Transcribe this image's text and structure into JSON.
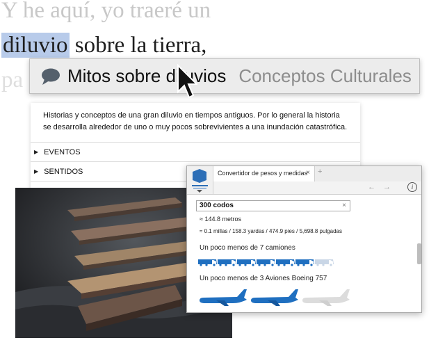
{
  "verse": {
    "line1": "Y he aquí, yo traeré un",
    "line2_highlight": "diluvio",
    "line2_rest": " sobre la tierra,",
    "line3": "pa"
  },
  "popup": {
    "icon": "speech-bubble-icon",
    "title": "Mitos sobre diluvios",
    "category": "Conceptos Culturales",
    "description": "Historias y conceptos de una gran diluvio en tiempos antiguos. Por lo general la historia se desarrolla alrededor de uno o muy pocos sobrevivientes a una inundación catastrófica.",
    "sections": [
      "EVENTOS",
      "SENTIDOS"
    ]
  },
  "converter": {
    "tab_title": "Convertidor de pesos y medidas",
    "tab_close": "×",
    "new_tab": "+",
    "nav_arrows": "← →",
    "info": "i",
    "search_value": "300 codos",
    "clear": "×",
    "result_primary": "≈ 144.8 metros",
    "result_secondary": "≈ 0.1 millas / 158.3 yardas / 474.9 pies / 5,698.8 pulgadas",
    "comparison_trucks": "Un poco menos de 7 camiones",
    "trucks_value": 6.9,
    "comparison_planes": "Un poco menos de 3 Aviones Boeing 757",
    "planes_value": 2.9,
    "accent": "#1f6fc0"
  }
}
